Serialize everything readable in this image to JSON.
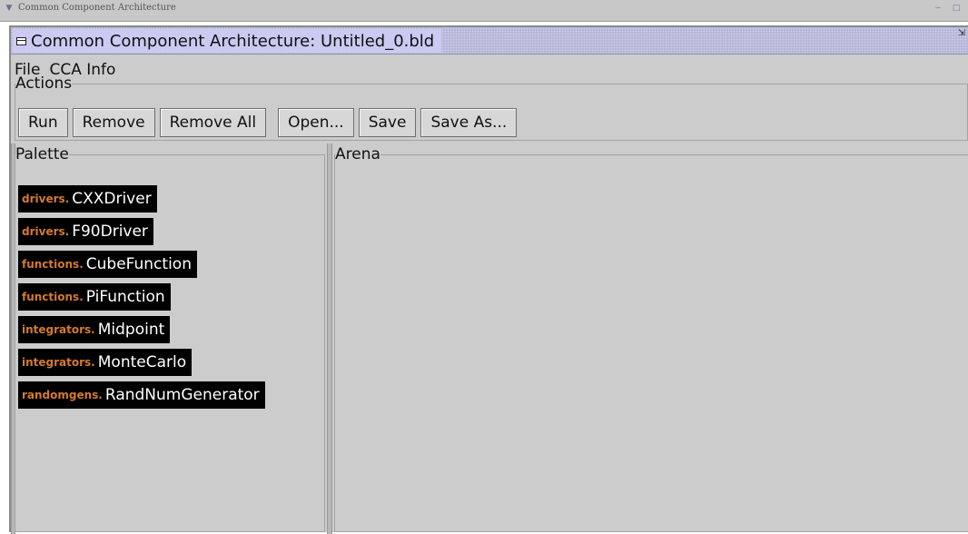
{
  "outer_window": {
    "title": "Common Component Architecture"
  },
  "frame": {
    "title": "Common Component Architecture: Untitled_0.bld"
  },
  "menu": [
    {
      "label": "File"
    },
    {
      "label": "CCA Info"
    }
  ],
  "actions": {
    "legend": "Actions",
    "buttons": [
      {
        "label": "Run"
      },
      {
        "label": "Remove"
      },
      {
        "label": "Remove All"
      },
      {
        "label": "Open..."
      },
      {
        "label": "Save"
      },
      {
        "label": "Save As..."
      }
    ]
  },
  "palette": {
    "legend": "Palette",
    "items": [
      {
        "package": "drivers.",
        "name": "CXXDriver"
      },
      {
        "package": "drivers.",
        "name": "F90Driver"
      },
      {
        "package": "functions.",
        "name": "CubeFunction"
      },
      {
        "package": "functions.",
        "name": "PiFunction"
      },
      {
        "package": "integrators.",
        "name": "Midpoint"
      },
      {
        "package": "integrators.",
        "name": "MonteCarlo"
      },
      {
        "package": "randomgens.",
        "name": "RandNumGenerator"
      }
    ]
  },
  "arena": {
    "legend": "Arena"
  },
  "colors": {
    "package_text": "#d47a2e",
    "component_background": "#000000",
    "component_text": "#ffffff",
    "panel_background": "#cccccc",
    "title_bar": "#b6b6d8"
  },
  "icons": {
    "outer_menu": "chevron-down-icon",
    "outer_minimize": "minimize-icon",
    "outer_maximize": "maximize-icon",
    "frame_menu": "window-menu-icon",
    "frame_restore": "restore-icon"
  }
}
